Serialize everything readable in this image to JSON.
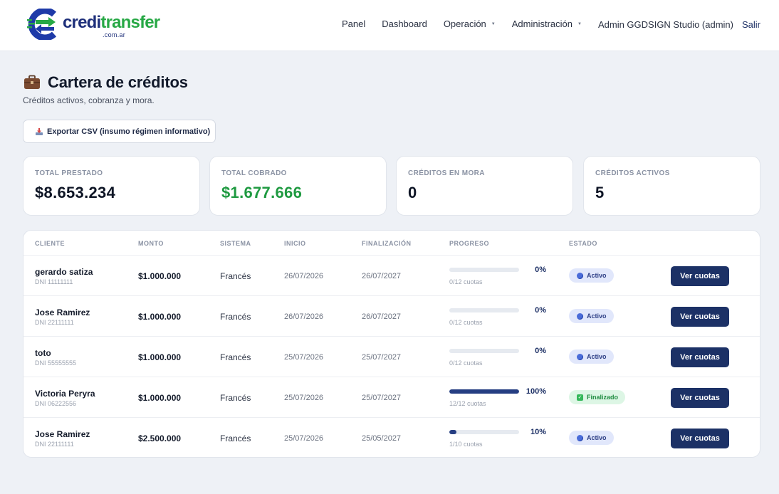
{
  "nav": {
    "logo_part1": "credi",
    "logo_part2": "transfer",
    "logo_sub": ".com.ar",
    "items": [
      {
        "label": "Panel",
        "dropdown": false
      },
      {
        "label": "Dashboard",
        "dropdown": false
      },
      {
        "label": "Operación",
        "dropdown": true
      },
      {
        "label": "Administración",
        "dropdown": true
      }
    ],
    "user": "Admin GGDSIGN Studio (admin)",
    "logout": "Salir"
  },
  "page": {
    "icon": "briefcase-icon",
    "title": "Cartera de créditos",
    "subtitle": "Créditos activos, cobranza y mora.",
    "export_label": "Exportar CSV (insumo régimen informativo)"
  },
  "stats": [
    {
      "label": "TOTAL PRESTADO",
      "value": "$8.653.234",
      "color": "#0f1626"
    },
    {
      "label": "TOTAL COBRADO",
      "value": "$1.677.666",
      "color": "#1f9a41"
    },
    {
      "label": "CRÉDITOS EN MORA",
      "value": "0",
      "color": "#0f1626"
    },
    {
      "label": "CRÉDITOS ACTIVOS",
      "value": "5",
      "color": "#0f1626"
    }
  ],
  "table": {
    "headers": [
      "CLIENTE",
      "MONTO",
      "SISTEMA",
      "INICIO",
      "FINALIZACIÓN",
      "PROGRESO",
      "ESTADO"
    ],
    "action_label": "Ver cuotas",
    "rows": [
      {
        "name": "gerardo satiza",
        "dni": "DNI 11111111",
        "amount": "$1.000.000",
        "system": "Francés",
        "start": "26/07/2026",
        "end": "26/07/2027",
        "progress": 0,
        "progress_label": "0%",
        "installments": "0/12 cuotas",
        "status": "Activo",
        "status_type": "activo"
      },
      {
        "name": "Jose Ramirez",
        "dni": "DNI 22111111",
        "amount": "$1.000.000",
        "system": "Francés",
        "start": "26/07/2026",
        "end": "26/07/2027",
        "progress": 0,
        "progress_label": "0%",
        "installments": "0/12 cuotas",
        "status": "Activo",
        "status_type": "activo"
      },
      {
        "name": "toto",
        "dni": "DNI 55555555",
        "amount": "$1.000.000",
        "system": "Francés",
        "start": "25/07/2026",
        "end": "25/07/2027",
        "progress": 0,
        "progress_label": "0%",
        "installments": "0/12 cuotas",
        "status": "Activo",
        "status_type": "activo"
      },
      {
        "name": "Victoria Peryra",
        "dni": "DNI 06222556",
        "amount": "$1.000.000",
        "system": "Francés",
        "start": "25/07/2026",
        "end": "25/07/2027",
        "progress": 100,
        "progress_label": "100%",
        "installments": "12/12 cuotas",
        "status": "Finalizado",
        "status_type": "finalizado"
      },
      {
        "name": "Jose Ramirez",
        "dni": "DNI 22111111",
        "amount": "$2.500.000",
        "system": "Francés",
        "start": "25/07/2026",
        "end": "25/05/2027",
        "progress": 10,
        "progress_label": "10%",
        "installments": "1/10 cuotas",
        "status": "Activo",
        "status_type": "activo"
      }
    ]
  }
}
